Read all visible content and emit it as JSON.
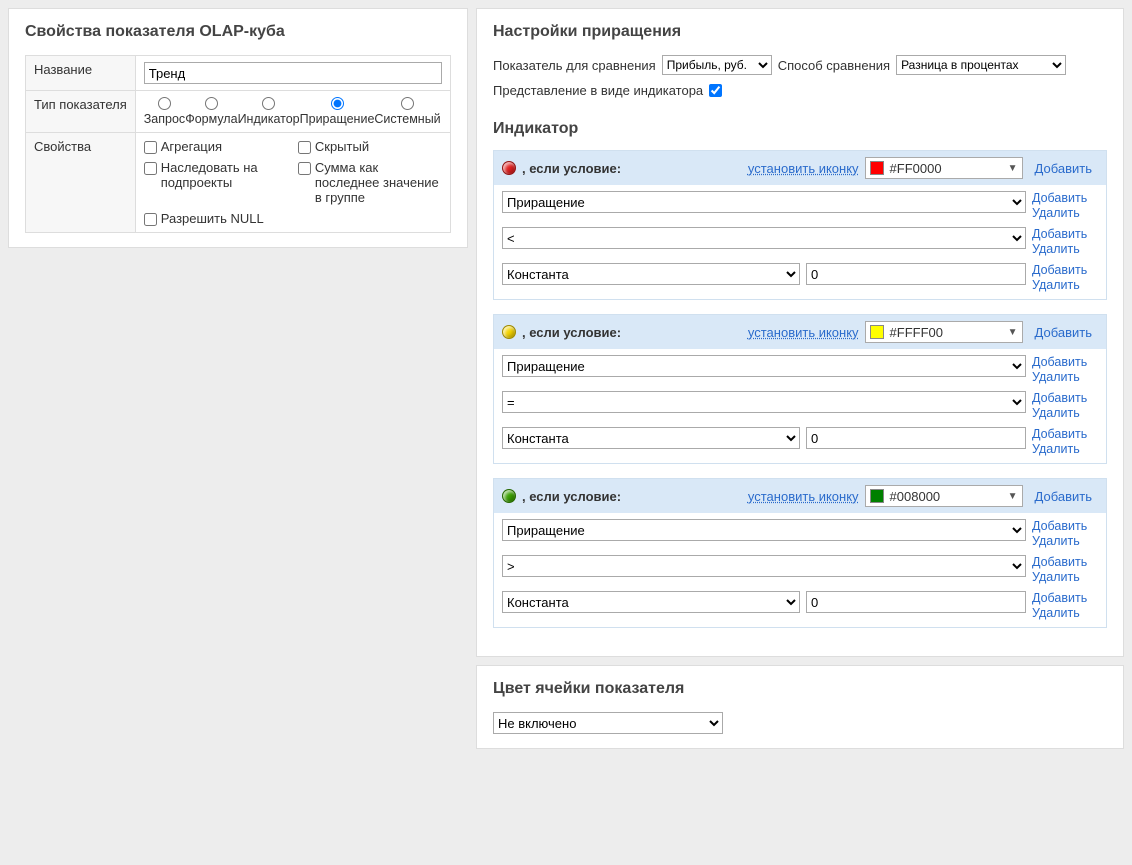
{
  "left": {
    "title": "Свойства показателя OLAP-куба",
    "name_label": "Название",
    "name_value": "Тренд",
    "type_label": "Тип показателя",
    "types": [
      "Запрос",
      "Формула",
      "Индикатор",
      "Приращение",
      "Системный"
    ],
    "type_selected_index": 3,
    "props_label": "Свойства",
    "checks": {
      "c0": "Агрегация",
      "c1": "Скрытый",
      "c2": "Наследовать на подпроекты",
      "c3": "Сумма как последнее значение в группе",
      "c4": "Разрешить NULL"
    }
  },
  "right": {
    "title": "Настройки приращения",
    "compare_label": "Показатель для сравнения",
    "compare_value": "Прибыль, руб.",
    "method_label": "Способ сравнения",
    "method_value": "Разница в процентах",
    "indicator_repr_label": "Представление в виде индикатора",
    "indicator_title": "Индикатор",
    "cond_text": ", если условие:",
    "set_icon": "установить иконку",
    "add": "Добавить",
    "delete": "Удалить",
    "indicators": [
      {
        "ball_color": "#e02020",
        "color_code": "#FF0000",
        "swatch": "#FF0000",
        "row1": "Приращение",
        "row2": "<",
        "row3_sel": "Константа",
        "row3_val": "0"
      },
      {
        "ball_color": "#f5d400",
        "color_code": "#FFFF00",
        "swatch": "#FFFF00",
        "row1": "Приращение",
        "row2": "=",
        "row3_sel": "Константа",
        "row3_val": "0"
      },
      {
        "ball_color": "#3aa000",
        "color_code": "#008000",
        "swatch": "#008000",
        "row1": "Приращение",
        "row2": ">",
        "row3_sel": "Константа",
        "row3_val": "0"
      }
    ],
    "cellcolor_title": "Цвет ячейки показателя",
    "cellcolor_value": "Не включено"
  }
}
